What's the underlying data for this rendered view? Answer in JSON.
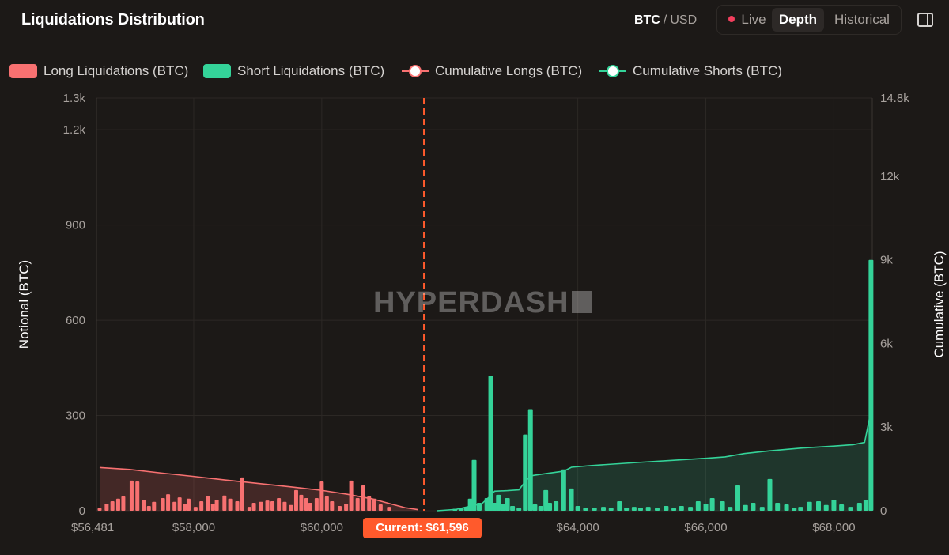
{
  "header": {
    "title": "Liquidations Distribution",
    "unit_btc": "BTC",
    "unit_sep": "/",
    "unit_usd": "USD",
    "tabs": {
      "live": "Live",
      "depth": "Depth",
      "historical": "Historical"
    },
    "panel_icon": "sidebar-panel-icon"
  },
  "legend": {
    "long": "Long Liquidations (BTC)",
    "short": "Short Liquidations (BTC)",
    "cum_long": "Cumulative Longs (BTC)",
    "cum_short": "Cumulative Shorts (BTC)"
  },
  "watermark": "HYPERDASH",
  "current_label": "Current: $61,596",
  "colors": {
    "long": "#f87171",
    "short": "#34d399",
    "current": "#ff5a2c",
    "bg": "#1c1917"
  },
  "chart_data": {
    "type": "bar",
    "xlabel": "",
    "ylabel": "Notional (BTC)",
    "y2label": "Cumulative (BTC)",
    "xlim": [
      56481,
      68600
    ],
    "ylim": [
      0,
      1300
    ],
    "y2lim": [
      0,
      14800
    ],
    "x_ticks": [
      "$56,481",
      "$58,000",
      "$60,000",
      "$64,000",
      "$66,000",
      "$68,000"
    ],
    "x_tick_values": [
      56481,
      58000,
      60000,
      64000,
      66000,
      68000
    ],
    "y_ticks": [
      "0",
      "300",
      "600",
      "900",
      "1.2k",
      "1.3k"
    ],
    "y_tick_values": [
      0,
      300,
      600,
      900,
      1200,
      1300
    ],
    "y2_ticks": [
      "0",
      "3k",
      "6k",
      "9k",
      "12k",
      "14.8k"
    ],
    "y2_tick_values": [
      0,
      3000,
      6000,
      9000,
      12000,
      14800
    ],
    "grid": true,
    "current_price": 61596,
    "long_liquidations": {
      "name": "Long Liquidations (BTC)",
      "x": [
        56530,
        56640,
        56730,
        56820,
        56900,
        57030,
        57120,
        57220,
        57300,
        57380,
        57520,
        57600,
        57700,
        57780,
        57860,
        57920,
        58030,
        58120,
        58220,
        58300,
        58360,
        58480,
        58570,
        58680,
        58760,
        58870,
        58940,
        59050,
        59150,
        59230,
        59330,
        59420,
        59520,
        59600,
        59680,
        59760,
        59820,
        59920,
        60000,
        60080,
        60160,
        60280,
        60380,
        60460,
        60560,
        60650,
        60740,
        60820,
        60920,
        61050
      ],
      "values": [
        8,
        22,
        30,
        38,
        45,
        95,
        92,
        35,
        15,
        28,
        40,
        52,
        28,
        42,
        22,
        38,
        12,
        30,
        45,
        22,
        35,
        48,
        38,
        30,
        105,
        12,
        25,
        28,
        32,
        30,
        40,
        28,
        18,
        65,
        50,
        40,
        25,
        40,
        92,
        45,
        30,
        15,
        22,
        95,
        40,
        80,
        45,
        38,
        20,
        12
      ]
    },
    "short_liquidations": {
      "name": "Short Liquidations (BTC)",
      "x": [
        62080,
        62180,
        62260,
        62320,
        62380,
        62460,
        62580,
        62640,
        62700,
        62760,
        62830,
        62900,
        62980,
        63080,
        63180,
        63260,
        63330,
        63420,
        63500,
        63560,
        63660,
        63780,
        63900,
        64000,
        64120,
        64260,
        64400,
        64520,
        64650,
        64760,
        64880,
        64980,
        65100,
        65240,
        65380,
        65500,
        65620,
        65760,
        65880,
        66000,
        66100,
        66260,
        66380,
        66500,
        66620,
        66740,
        66880,
        67000,
        67120,
        67260,
        67380,
        67480,
        67620,
        67760,
        67880,
        68000,
        68120,
        68260,
        68400,
        68500,
        68580
      ],
      "values": [
        6,
        8,
        12,
        38,
        160,
        25,
        40,
        425,
        25,
        50,
        20,
        40,
        15,
        8,
        240,
        320,
        20,
        15,
        65,
        25,
        30,
        130,
        70,
        15,
        8,
        10,
        12,
        8,
        30,
        10,
        12,
        10,
        12,
        8,
        15,
        8,
        15,
        12,
        30,
        22,
        40,
        30,
        12,
        80,
        18,
        25,
        12,
        100,
        25,
        20,
        10,
        12,
        28,
        30,
        18,
        35,
        20,
        12,
        25,
        35,
        790
      ]
    },
    "cumulative_longs": {
      "name": "Cumulative Longs (BTC)",
      "x": [
        56530,
        57000,
        57500,
        58000,
        58500,
        59000,
        59500,
        60000,
        60400,
        60800,
        61100,
        61300,
        61500
      ],
      "values": [
        1550,
        1480,
        1350,
        1230,
        1100,
        980,
        860,
        730,
        590,
        420,
        230,
        110,
        40
      ]
    },
    "cumulative_shorts": {
      "name": "Cumulative Shorts (BTC)",
      "x": [
        61800,
        62100,
        62300,
        62500,
        62620,
        62700,
        62900,
        63080,
        63180,
        63260,
        63400,
        63780,
        63900,
        64200,
        64600,
        65000,
        65500,
        66000,
        66300,
        66600,
        67000,
        67500,
        68000,
        68300,
        68480,
        68560,
        68600
      ],
      "values": [
        0,
        50,
        150,
        250,
        500,
        700,
        720,
        750,
        1050,
        1250,
        1300,
        1420,
        1560,
        1620,
        1680,
        1740,
        1810,
        1880,
        1930,
        2050,
        2150,
        2250,
        2320,
        2370,
        2450,
        3350,
        8700
      ]
    }
  }
}
